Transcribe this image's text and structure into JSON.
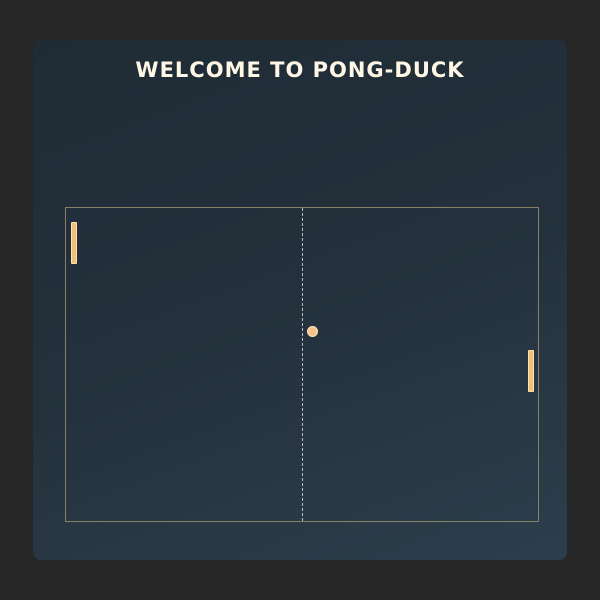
{
  "game": {
    "title": "WELCOME TO PONG-DUCK"
  },
  "colors": {
    "page_background": "#262626",
    "card_gradient_start": "#1f2b35",
    "card_gradient_end": "#2c3e4c",
    "title_text": "#fff7e6",
    "court_border": "#8a8066",
    "net": "#b8bcc4",
    "paddle": "#f0bf78",
    "ball": "#f6c48a"
  }
}
